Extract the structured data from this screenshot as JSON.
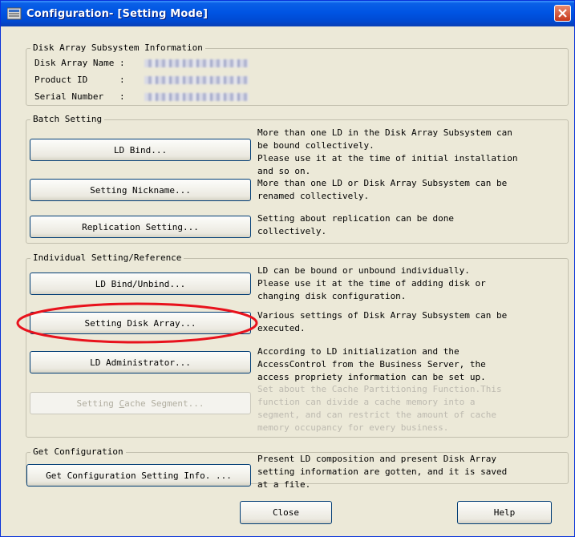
{
  "window": {
    "title": "Configuration- [Setting Mode]"
  },
  "disk_info": {
    "legend": "Disk Array Subsystem Information",
    "rows": [
      {
        "label": "Disk Array Name :"
      },
      {
        "label": "Product ID      :"
      },
      {
        "label": "Serial Number   :"
      }
    ]
  },
  "batch": {
    "legend": "Batch Setting",
    "ld_bind_label": "LD Bind...",
    "ld_bind_desc": "More than one LD in the Disk Array Subsystem can\nbe bound collectively.\nPlease use it at the time of initial installation\nand so on.",
    "nickname_label": "Setting Nickname...",
    "nickname_desc": "More than one LD or Disk Array Subsystem can be\nrenamed collectively.",
    "replication_label": "Replication Setting...",
    "replication_desc": "Setting about replication can be done\ncollectively."
  },
  "individual": {
    "legend": "Individual Setting/Reference",
    "ld_bind_unbind_label": "LD Bind/Unbind...",
    "ld_bind_unbind_desc": "LD can be bound or unbound individually.\nPlease use it at the time of adding disk or\nchanging disk configuration.",
    "disk_array_label": "Setting Disk Array...",
    "disk_array_desc": "Various settings of Disk Array Subsystem can be\nexecuted.",
    "ld_admin_label": "LD Administrator...",
    "ld_admin_desc": "According to LD initialization and the\nAccessControl from the Business Server, the\naccess propriety information can be set up.",
    "cache_label_pre": "Setting ",
    "cache_label_u": "C",
    "cache_label_post": "ache Segment...",
    "cache_desc": "Set about the Cache Partitioning Function.This\nfunction can divide a cache memory into a\nsegment, and can restrict the amount of cache\nmemory occupancy for every business."
  },
  "get_config": {
    "legend": "Get Configuration",
    "button_label": "Get Configuration Setting Info. ...",
    "desc": "Present LD composition and present Disk Array\nsetting information are gotten, and it is saved\nat a file."
  },
  "footer": {
    "close_label": "Close",
    "help_label": "Help"
  },
  "colors": {
    "titlebar": "#0054e3",
    "highlight_ellipse": "#e8121c",
    "dialog_bg": "#ece9d8"
  }
}
